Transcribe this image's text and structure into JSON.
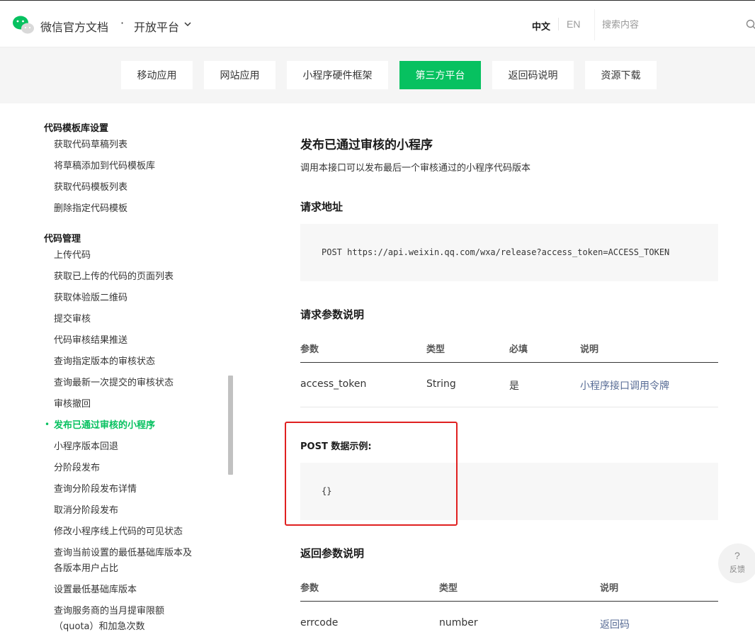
{
  "header": {
    "brand": "微信官方文档",
    "separator": "·",
    "platform": "开放平台",
    "lang_cn": "中文",
    "lang_en": "EN",
    "search_placeholder": "搜索内容"
  },
  "tabs": [
    {
      "label": "移动应用",
      "active": false
    },
    {
      "label": "网站应用",
      "active": false
    },
    {
      "label": "小程序硬件框架",
      "active": false
    },
    {
      "label": "第三方平台",
      "active": true
    },
    {
      "label": "返回码说明",
      "active": false
    },
    {
      "label": "资源下载",
      "active": false
    }
  ],
  "sidebar": {
    "group1": "代码模板库设置",
    "group1_items": [
      "获取代码草稿列表",
      "将草稿添加到代码模板库",
      "获取代码模板列表",
      "删除指定代码模板"
    ],
    "group2": "代码管理",
    "group2_items": [
      "上传代码",
      "获取已上传的代码的页面列表",
      "获取体验版二维码",
      "提交审核",
      "代码审核结果推送",
      "查询指定版本的审核状态",
      "查询最新一次提交的审核状态",
      "审核撤回",
      "发布已通过审核的小程序",
      "小程序版本回退",
      "分阶段发布",
      "查询分阶段发布详情",
      "取消分阶段发布",
      "修改小程序线上代码的可见状态",
      "查询当前设置的最低基础库版本及",
      "各版本用户占比",
      "设置最低基础库版本",
      "查询服务商的当月提审限额",
      "（quota）和加急次数"
    ],
    "bullet": "•"
  },
  "main": {
    "title": "发布已通过审核的小程序",
    "description": "调用本接口可以发布最后一个审核通过的小程序代码版本",
    "request_url_heading": "请求地址",
    "request_url": "POST https://api.weixin.qq.com/wxa/release?access_token=ACCESS_TOKEN",
    "params_heading": "请求参数说明",
    "params_headers": [
      "参数",
      "类型",
      "必填",
      "说明"
    ],
    "params_row": [
      "access_token",
      "String",
      "是",
      "小程序接口调用令牌"
    ],
    "post_example_heading": "POST 数据示例:",
    "post_example_code": "{}",
    "return_heading": "返回参数说明",
    "return_headers": [
      "参数",
      "类型",
      "说明"
    ],
    "return_row": [
      "errcode",
      "number",
      "返回码"
    ]
  },
  "feedback": {
    "icon": "?",
    "label": "反馈"
  },
  "colors": {
    "accent": "#07c160",
    "link": "#576b95",
    "highlight_box": "#e02020"
  }
}
